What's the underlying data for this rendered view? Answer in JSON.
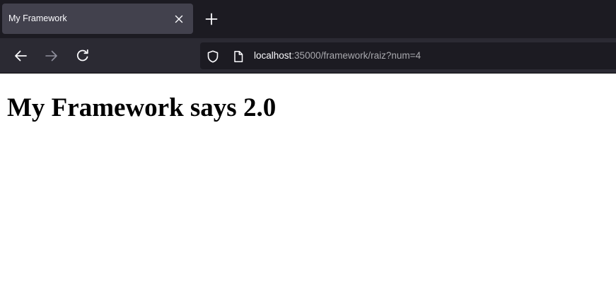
{
  "tab": {
    "title": "My Framework"
  },
  "urlbar": {
    "host": "localhost",
    "path": ":35000/framework/raiz?num=4"
  },
  "page": {
    "heading": "My Framework says 2.0"
  },
  "colors": {
    "tab_strip_bg": "#1c1b22",
    "active_tab_bg": "#42414d",
    "toolbar_bg": "#2b2a33",
    "urlbar_bg": "#1c1b22",
    "icon_color": "#fbfbfe",
    "disabled_icon_color": "#8f8f9d"
  },
  "icons": {
    "tab_close": "close-icon",
    "new_tab": "plus-icon",
    "back": "arrow-left-icon",
    "forward": "arrow-right-icon",
    "reload": "reload-icon",
    "tracking_protection": "shield-icon",
    "page_info": "page-icon"
  }
}
